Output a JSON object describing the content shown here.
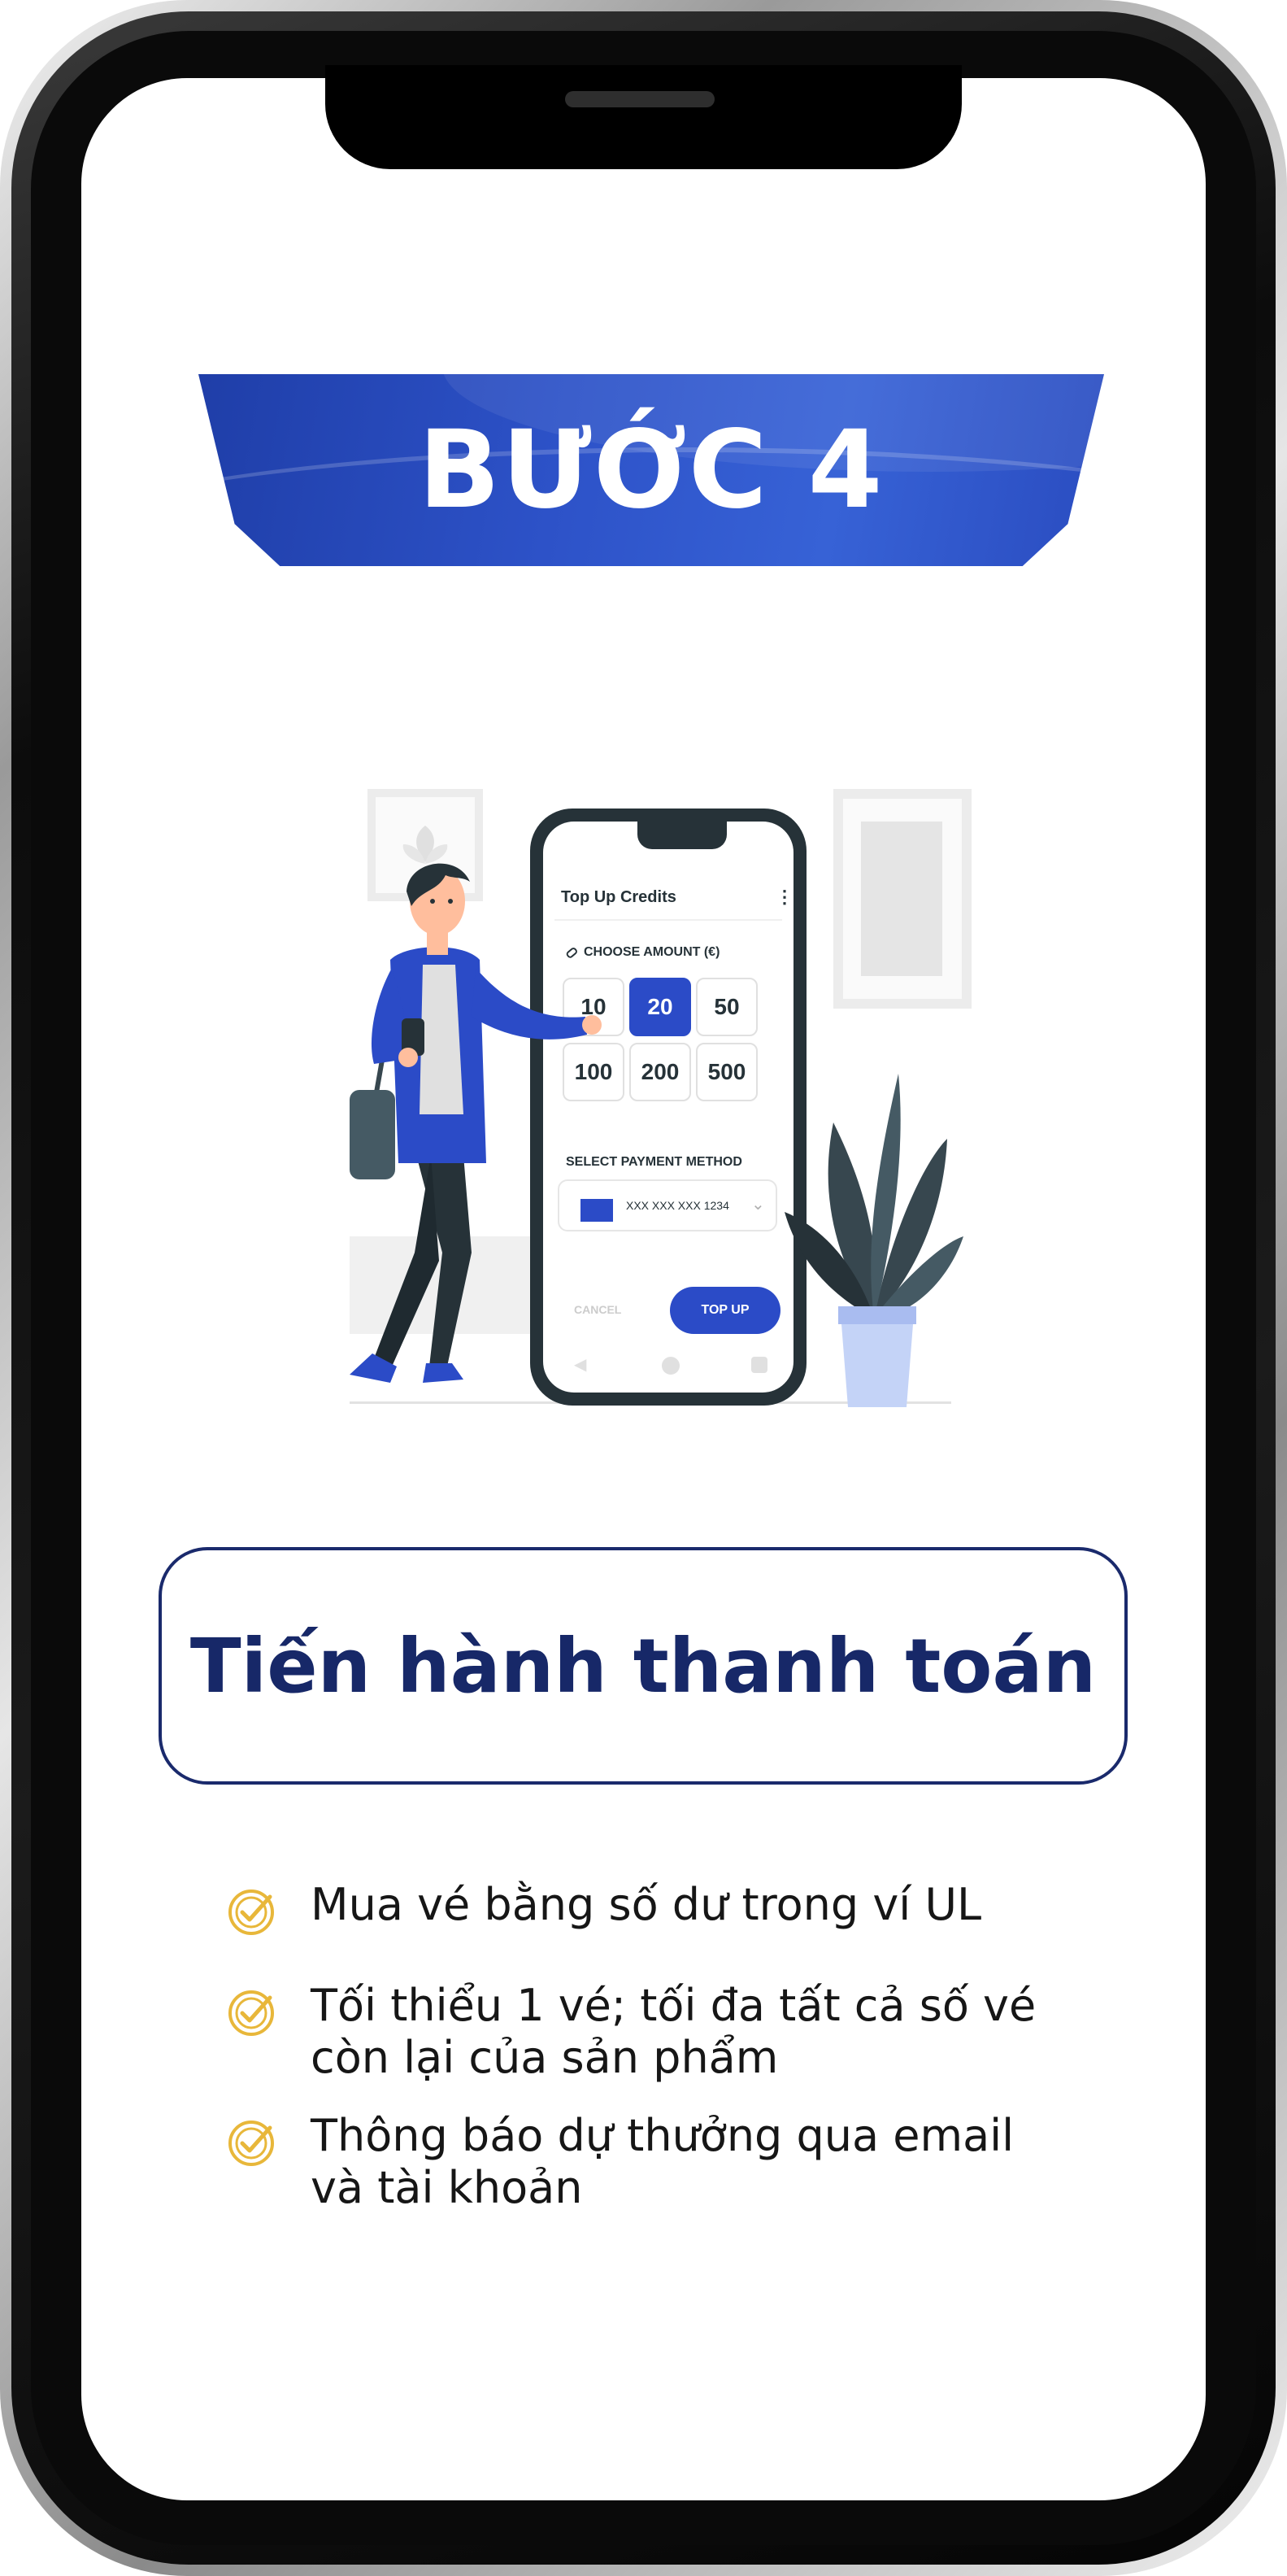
{
  "banner": {
    "title": "BƯỚC 4"
  },
  "mockup": {
    "title": "Top Up Credits",
    "menu_icon": "more-vertical-icon",
    "amount_label": "CHOOSE AMOUNT (€)",
    "amount_icon": "tag-icon",
    "amounts": [
      "10",
      "20",
      "50",
      "100",
      "200",
      "500"
    ],
    "selected_amount": "20",
    "payment_label": "SELECT PAYMENT METHOD",
    "card_number": "XXX XXX XXX 1234",
    "cancel_label": "CANCEL",
    "topup_label": "TOP UP"
  },
  "subtitle": "Tiến hành thanh toán",
  "bullets": [
    {
      "icon": "check-circle-icon",
      "text": "Mua vé bằng số dư trong ví UL"
    },
    {
      "icon": "check-circle-icon",
      "text": "Tối thiểu 1 vé; tối đa tất cả số vé\ncòn lại của sản phẩm"
    },
    {
      "icon": "check-circle-icon",
      "text": "Thông báo dự thưởng qua email\nvà tài khoản"
    }
  ],
  "colors": {
    "brand_blue": "#2b4bc7",
    "navy": "#172868",
    "check_gold": "#e8b73a",
    "plant": "#37474f",
    "pot": "#c4d3f7"
  }
}
